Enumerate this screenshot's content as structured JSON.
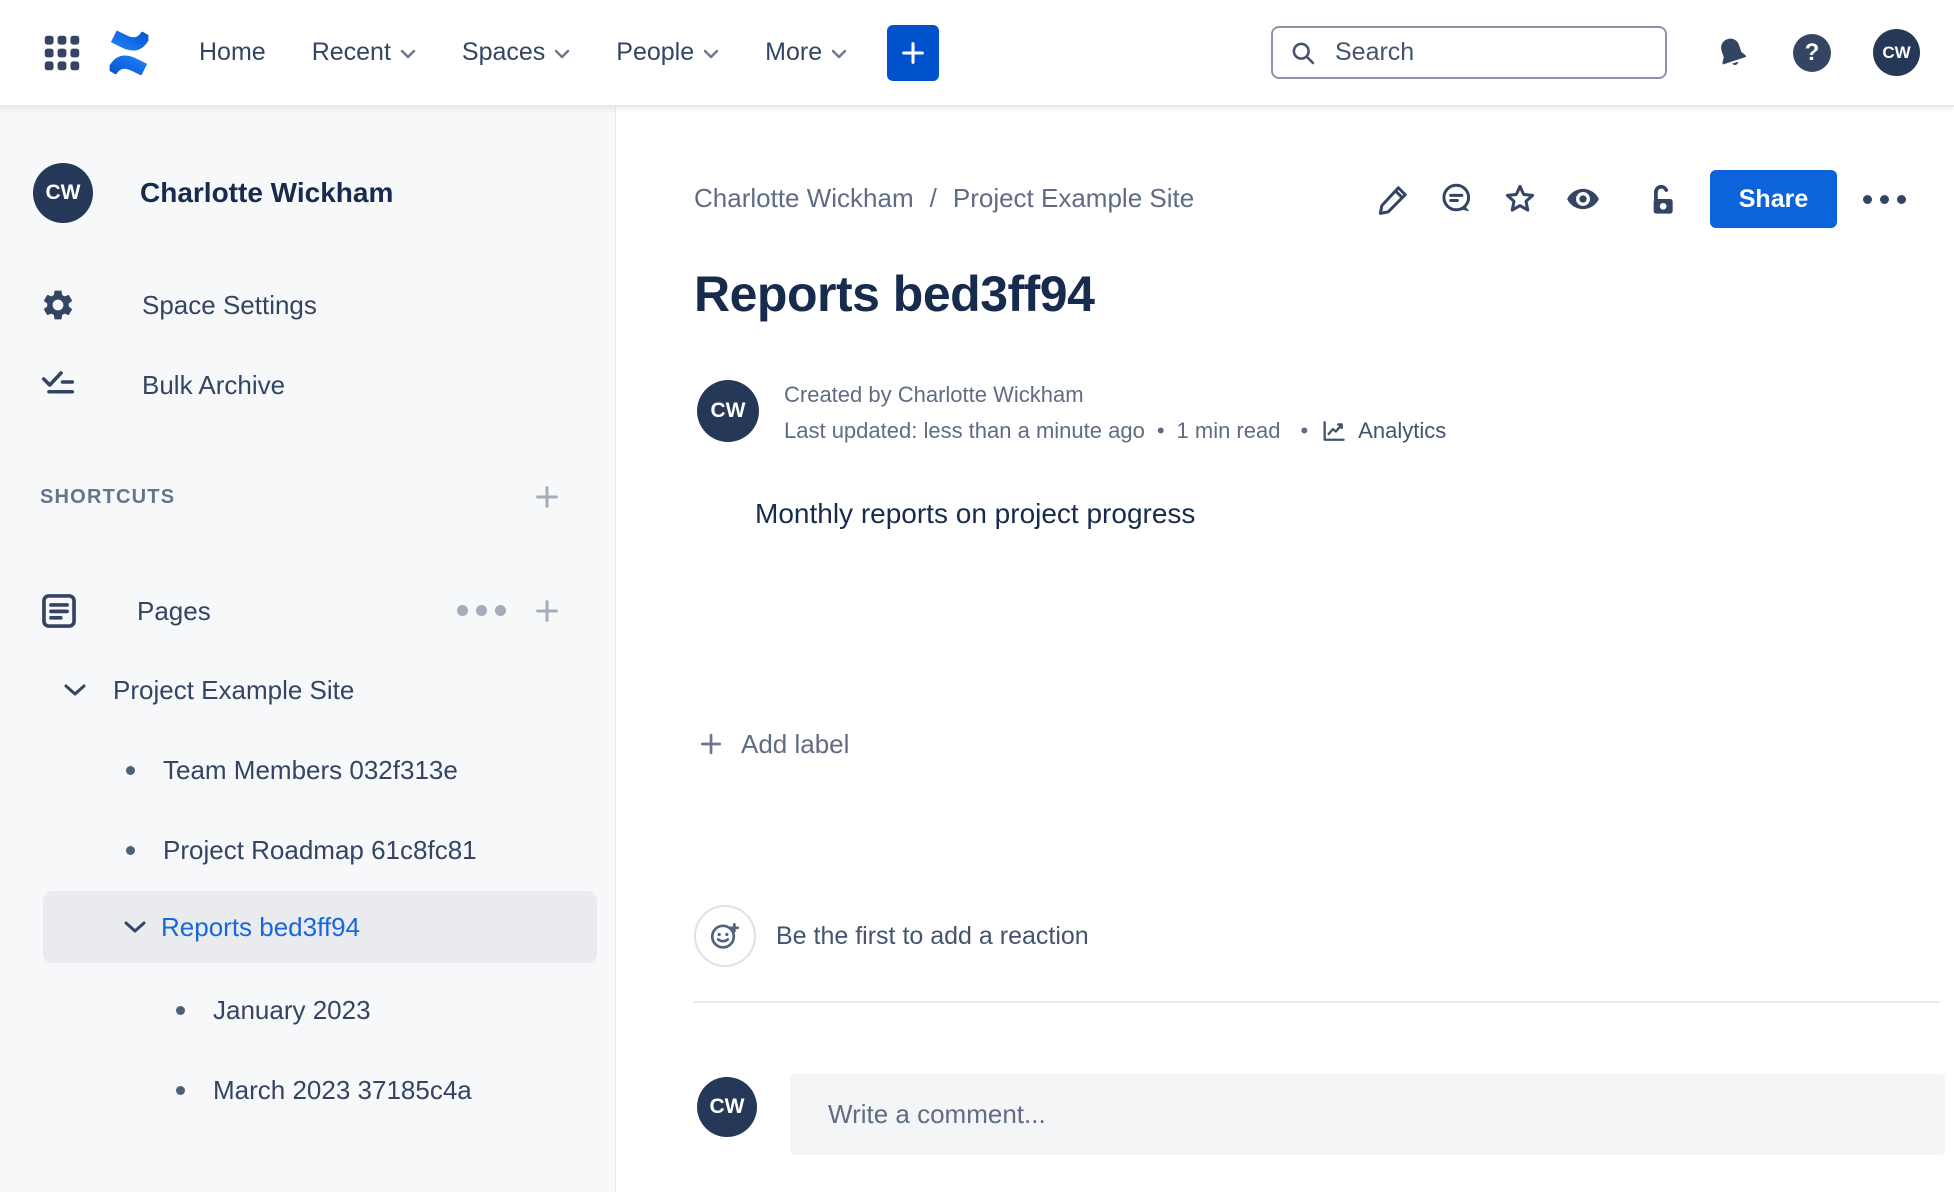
{
  "topnav": {
    "menu": [
      {
        "label": "Home"
      },
      {
        "label": "Recent"
      },
      {
        "label": "Spaces"
      },
      {
        "label": "People"
      },
      {
        "label": "More"
      }
    ],
    "search_placeholder": "Search",
    "help_glyph": "?",
    "avatar_initials": "CW"
  },
  "sidebar": {
    "avatar_initials": "CW",
    "space_owner": "Charlotte Wickham",
    "settings_label": "Space Settings",
    "bulk_archive_label": "Bulk Archive",
    "shortcuts_header": "SHORTCUTS",
    "pages_label": "Pages",
    "tree": {
      "items": [
        {
          "label": "Project Example Site"
        },
        {
          "label": "Team Members 032f313e"
        },
        {
          "label": "Project Roadmap 61c8fc81"
        },
        {
          "label": "Reports bed3ff94"
        },
        {
          "label": "January 2023"
        },
        {
          "label": "March 2023 37185c4a"
        }
      ]
    }
  },
  "content": {
    "breadcrumb": {
      "part1": "Charlotte Wickham",
      "separator": "/",
      "part2": "Project Example Site"
    },
    "share_label": "Share",
    "title": "Reports bed3ff94",
    "byline": {
      "avatar_initials": "CW",
      "created": "Created by Charlotte Wickham",
      "updated": "Last updated: less than a minute ago",
      "dot": "•",
      "read_time": "1 min read",
      "analytics_label": "Analytics"
    },
    "body_text": "Monthly reports on project progress",
    "add_label_text": "Add label",
    "reaction_prompt": "Be the first to add a reaction",
    "comment_placeholder": "Write a comment...",
    "comment_avatar_initials": "CW"
  },
  "colors": {
    "create_blue": "#0052CC",
    "share_blue": "#0C63DB",
    "selected_blue": "#1868DB",
    "navy_text": "#172B4D",
    "slate_text": "#344563",
    "muted_text": "#5E6C84",
    "sidebar_bg": "#F7F8F9",
    "selected_row_bg": "#E9EBEE",
    "comment_box_bg": "#F4F5F7"
  }
}
